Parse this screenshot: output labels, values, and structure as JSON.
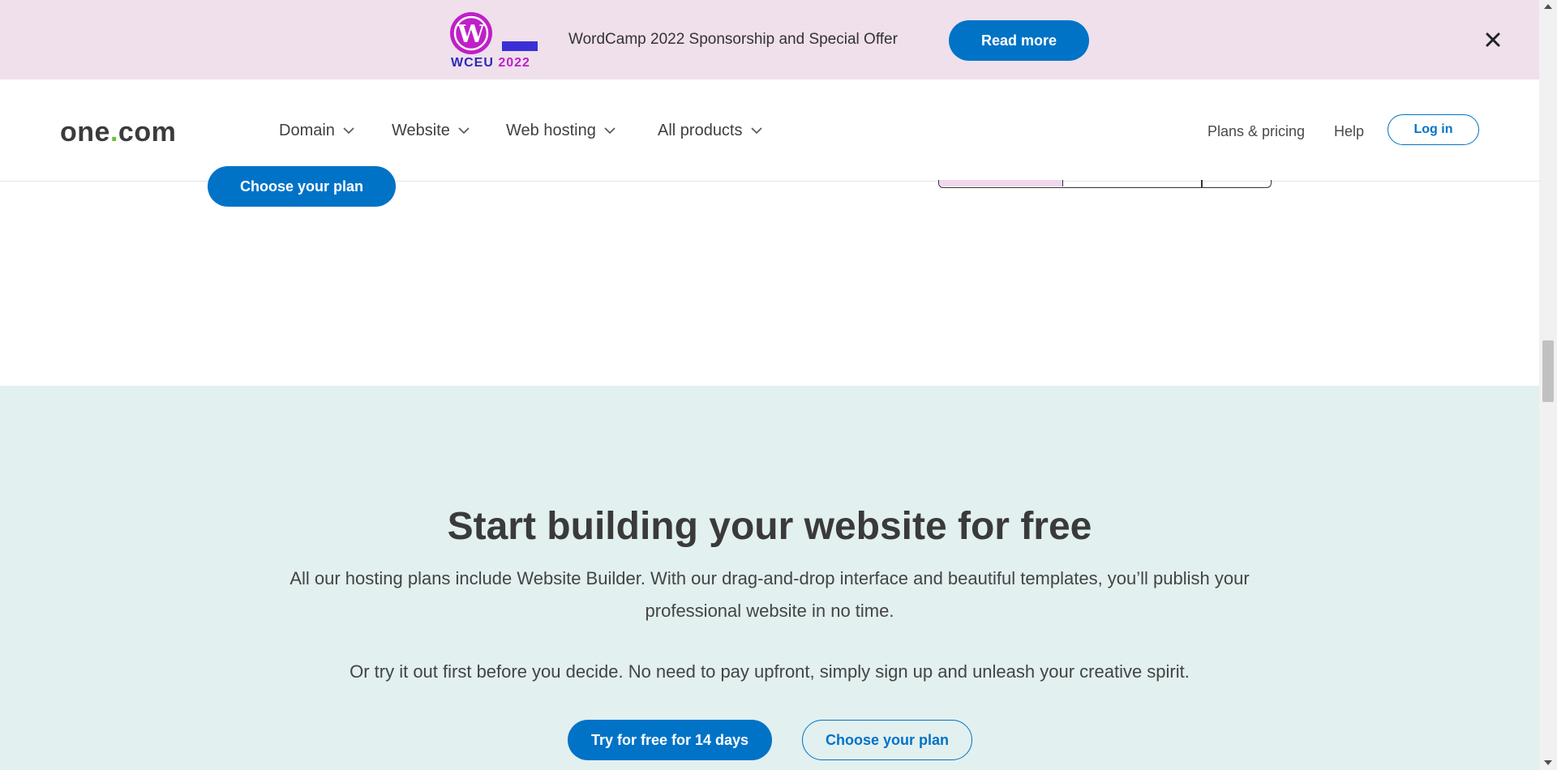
{
  "promo": {
    "logo_text": "WCEU",
    "logo_year": "2022",
    "text": "WordCamp 2022 Sponsorship and Special Offer",
    "button": "Read more"
  },
  "header": {
    "logo": "one",
    "logo_dot": ".",
    "logo_suffix": "com",
    "nav": [
      "Domain",
      "Website",
      "Web hosting",
      "All products"
    ],
    "plans_pricing": "Plans & pricing",
    "help": "Help",
    "login": "Log in"
  },
  "upper": {
    "choose_plan": "Choose your plan"
  },
  "hero": {
    "heading": "Start building your website for free",
    "paragraph": "All our hosting plans include Website Builder. With our drag-and-drop interface and beautiful templates, you’ll publish your professional website in no time.",
    "paragraph2": "Or try it out first before you decide. No need to pay upfront, simply sign up and unleash your creative spirit.",
    "try_button": "Try for free for 14 days",
    "choose_button": "Choose your plan"
  },
  "colors": {
    "accent": "#0073c7",
    "promo_bg": "#efe0ec",
    "section_bg": "#e2f0ef",
    "wp_magenta": "#c01fc9",
    "wp_blue": "#3a2fd6",
    "logo_dot": "#6cbf2e"
  }
}
